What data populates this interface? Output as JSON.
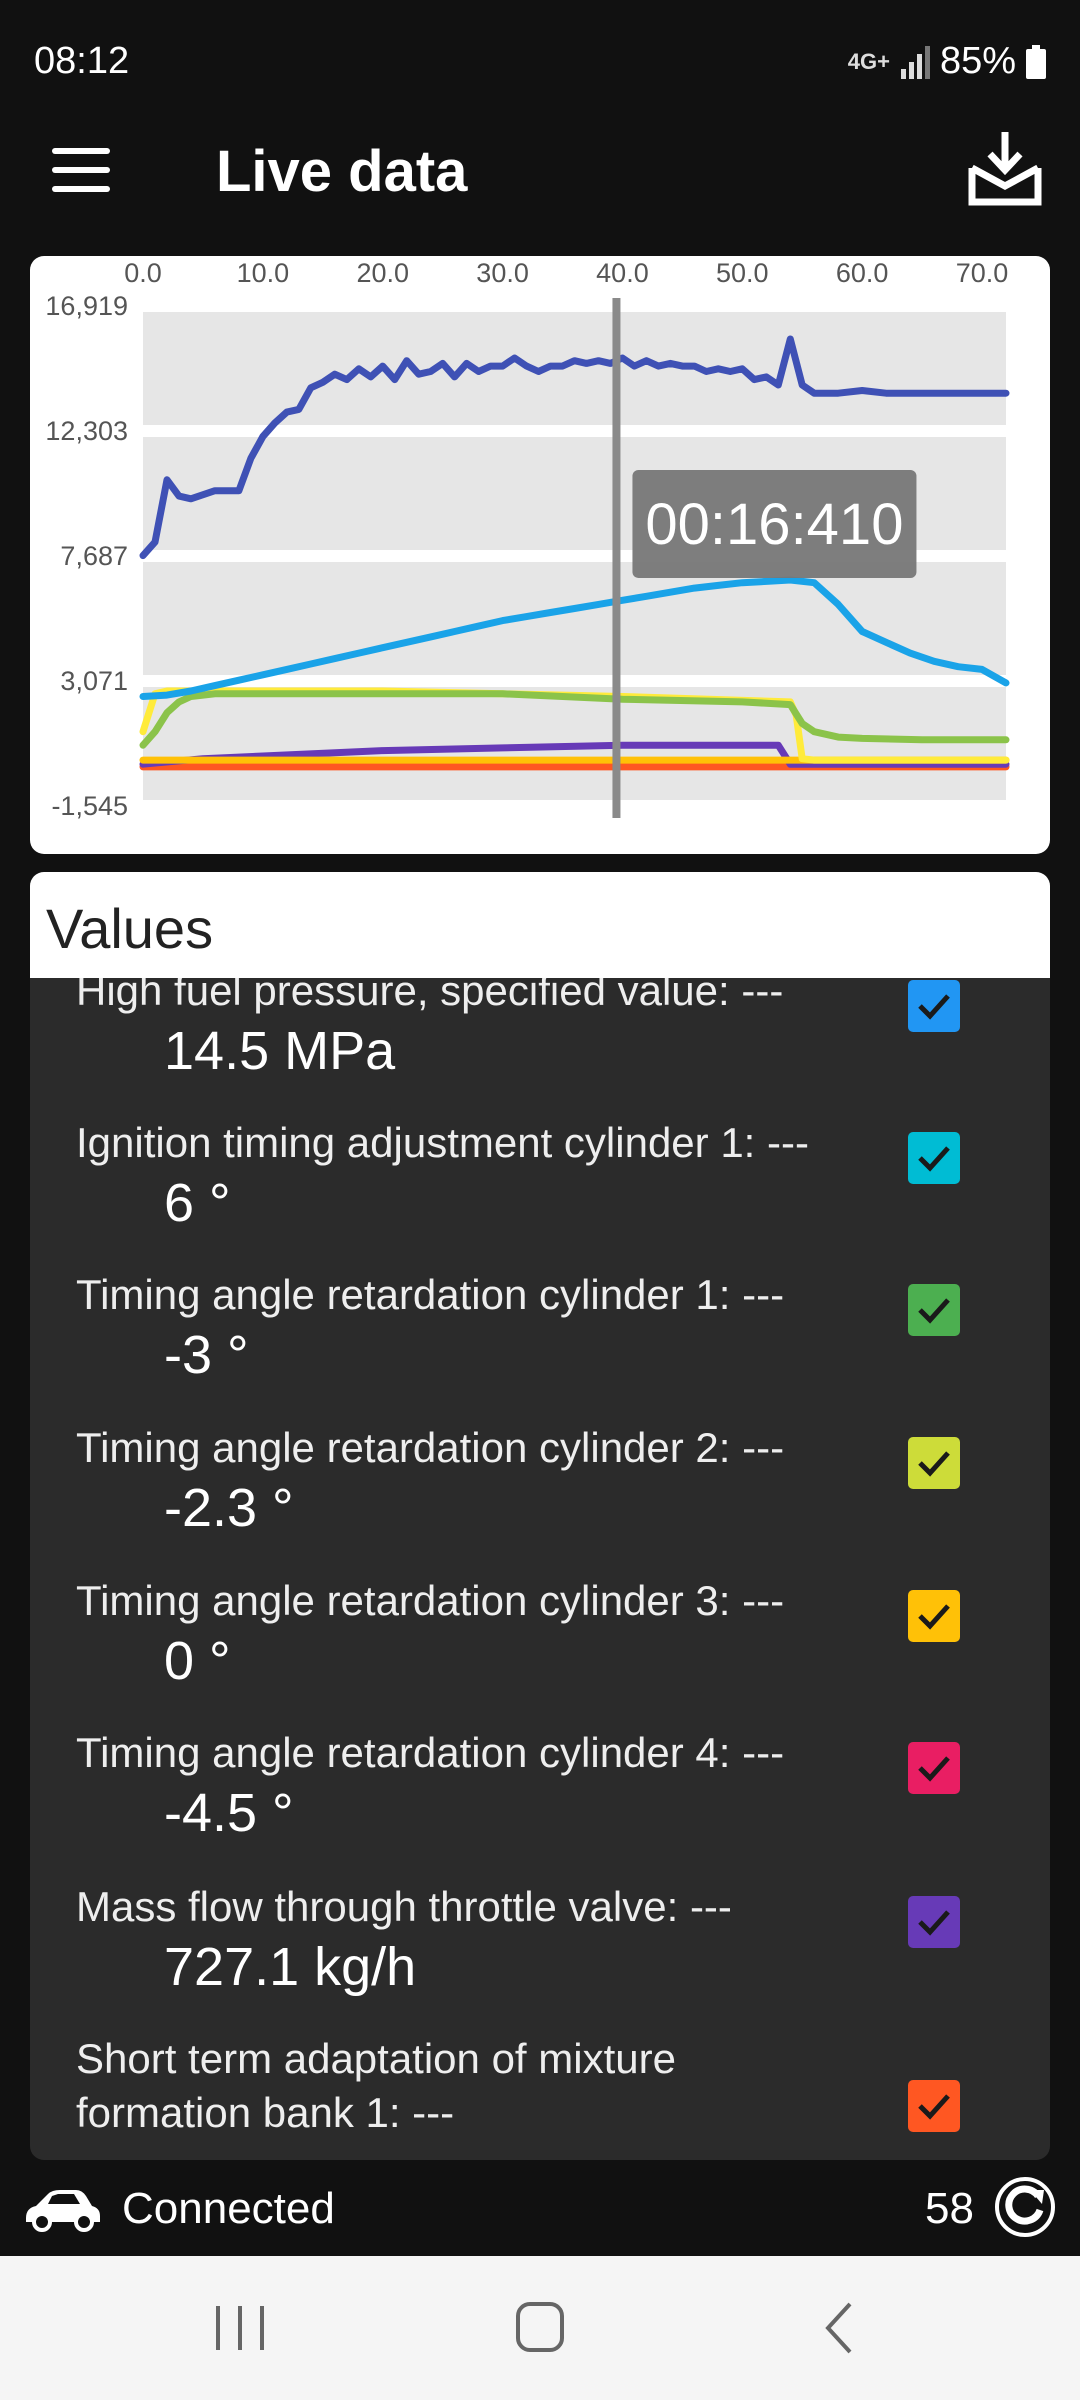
{
  "status": {
    "time": "08:12",
    "network": "4G+",
    "battery": "85%"
  },
  "app": {
    "title": "Live data"
  },
  "chart_data": {
    "type": "line",
    "x_ticks": [
      "0.0",
      "10.0",
      "20.0",
      "30.0",
      "40.0",
      "50.0",
      "60.0",
      "70.0"
    ],
    "y_ticks": [
      "16,919",
      "12,303",
      "7,687",
      "3,071",
      "-1,545"
    ],
    "xlim": [
      0,
      72
    ],
    "ylim": [
      -1545,
      16919
    ],
    "cursor_x": 39.5,
    "tooltip": "00:16:410",
    "series": [
      {
        "color": "#3f51b5",
        "x": [
          0,
          1,
          2,
          3,
          4,
          6,
          8,
          9,
          10,
          11,
          12,
          13,
          14,
          15,
          16,
          17,
          18,
          19,
          20,
          21,
          22,
          23,
          24,
          25,
          26,
          27,
          28,
          29,
          30,
          31,
          32,
          33,
          34,
          35,
          36,
          37,
          38,
          39,
          40,
          41,
          42,
          43,
          44,
          45,
          46,
          47,
          48,
          49,
          50,
          51,
          52,
          53,
          54,
          55,
          56,
          57,
          58,
          60,
          62,
          64,
          66,
          68,
          70,
          72
        ],
        "y": [
          7700,
          8200,
          10500,
          9900,
          9800,
          10100,
          10100,
          11300,
          12100,
          12600,
          13000,
          13100,
          13900,
          14100,
          14400,
          14200,
          14600,
          14300,
          14700,
          14200,
          14900,
          14400,
          14500,
          14800,
          14300,
          14800,
          14500,
          14700,
          14700,
          15000,
          14700,
          14500,
          14700,
          14700,
          14900,
          14800,
          14900,
          14800,
          15000,
          14700,
          14900,
          14700,
          14800,
          14700,
          14700,
          14500,
          14600,
          14500,
          14600,
          14200,
          14300,
          14000,
          15700,
          14000,
          13700,
          13700,
          13700,
          13800,
          13700,
          13700,
          13700,
          13700,
          13700,
          13700
        ]
      },
      {
        "color": "#1aa3e8",
        "x": [
          0,
          2,
          4,
          6,
          8,
          10,
          12,
          14,
          16,
          18,
          20,
          22,
          24,
          26,
          28,
          30,
          32,
          34,
          36,
          38,
          40,
          42,
          44,
          46,
          48,
          50,
          52,
          54,
          56,
          58,
          60,
          62,
          64,
          66,
          68,
          70,
          72
        ],
        "y": [
          2500,
          2550,
          2700,
          2900,
          3100,
          3300,
          3500,
          3700,
          3900,
          4100,
          4300,
          4500,
          4700,
          4900,
          5100,
          5300,
          5450,
          5600,
          5750,
          5900,
          6050,
          6200,
          6350,
          6500,
          6600,
          6700,
          6750,
          6800,
          6700,
          5900,
          4900,
          4500,
          4100,
          3800,
          3600,
          3500,
          3000
        ]
      },
      {
        "color": "#8bc34a",
        "x": [
          0,
          1,
          2,
          3,
          4,
          6,
          10,
          20,
          30,
          40,
          50,
          54,
          55,
          56,
          58,
          60,
          65,
          72
        ],
        "y": [
          700,
          1200,
          1900,
          2300,
          2500,
          2600,
          2600,
          2600,
          2600,
          2400,
          2300,
          2200,
          1500,
          1200,
          1000,
          950,
          900,
          900
        ]
      },
      {
        "color": "#ffeb3b",
        "x": [
          0,
          1,
          2,
          4,
          10,
          20,
          30,
          40,
          54,
          54.5,
          55,
          56,
          60,
          72
        ],
        "y": [
          1200,
          2600,
          2700,
          2700,
          2700,
          2700,
          2600,
          2500,
          2300,
          1800,
          200,
          150,
          150,
          150
        ]
      },
      {
        "color": "#ffc107",
        "x": [
          0,
          10,
          20,
          30,
          40,
          50,
          53,
          54,
          60,
          72
        ],
        "y": [
          150,
          150,
          150,
          150,
          150,
          150,
          150,
          150,
          150,
          150
        ]
      },
      {
        "color": "#673ab7",
        "x": [
          0,
          5,
          10,
          20,
          30,
          40,
          50,
          53,
          54,
          60,
          72
        ],
        "y": [
          0,
          200,
          300,
          500,
          600,
          700,
          700,
          700,
          0,
          0,
          0
        ]
      },
      {
        "color": "#ff5722",
        "x": [
          0,
          72
        ],
        "y": [
          -100,
          -100
        ]
      }
    ]
  },
  "values": {
    "title": "Values",
    "items": [
      {
        "label": "High fuel pressure, specified value: ---",
        "value": "14.5 MPa",
        "color": "#2196f3"
      },
      {
        "label": "Ignition timing adjustment cylinder 1: ---",
        "value": "6 °",
        "color": "#00bcd4"
      },
      {
        "label": "Timing angle retardation cylinder 1: ---",
        "value": "-3 °",
        "color": "#4caf50"
      },
      {
        "label": "Timing angle retardation cylinder 2: ---",
        "value": "-2.3 °",
        "color": "#cddc39"
      },
      {
        "label": "Timing angle retardation cylinder 3: ---",
        "value": "0 °",
        "color": "#ffc107"
      },
      {
        "label": "Timing angle retardation cylinder 4: ---",
        "value": "-4.5 °",
        "color": "#e91e63"
      },
      {
        "label": "Mass flow through throttle valve: ---",
        "value": "727.1 kg/h",
        "color": "#673ab7"
      },
      {
        "label": "Short term adaptation of mixture formation bank 1: ---",
        "value": "",
        "color": "#ff5722"
      }
    ]
  },
  "footer": {
    "connection": "Connected",
    "count": "58"
  }
}
